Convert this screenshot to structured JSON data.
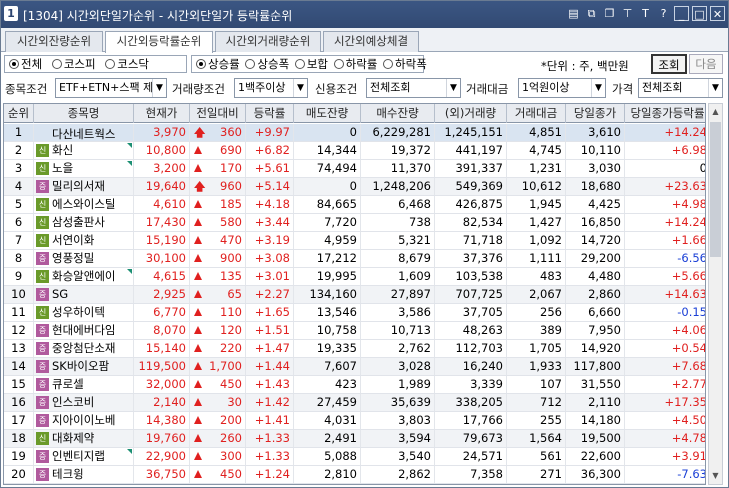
{
  "window": {
    "number": "1",
    "title": "[1304] 시간외단일가순위 - 시간외단일가 등락률순위",
    "toolbar_icons": [
      "monitor-icon",
      "copy-icon",
      "restore-icon",
      "pin-icon",
      "font-icon",
      "help-icon",
      "minimize-icon",
      "maximize-icon",
      "close-icon"
    ],
    "toolbar_glyphs": [
      "▤",
      "⧉",
      "❐",
      "⊤",
      "T",
      "?",
      "_",
      "□",
      "✕"
    ]
  },
  "tabs": [
    {
      "label": "시간외잔량순위",
      "active": false
    },
    {
      "label": "시간외등락률순위",
      "active": true
    },
    {
      "label": "시간외거래량순위",
      "active": false
    },
    {
      "label": "시간외예상체결",
      "active": false
    }
  ],
  "market_radios": [
    {
      "label": "전체",
      "checked": true
    },
    {
      "label": "코스피",
      "checked": false
    },
    {
      "label": "코스닥",
      "checked": false
    }
  ],
  "direction_radios": [
    {
      "label": "상승률",
      "checked": true
    },
    {
      "label": "상승폭",
      "checked": false
    },
    {
      "label": "보합",
      "checked": false
    },
    {
      "label": "하락률",
      "checked": false
    },
    {
      "label": "하락폭",
      "checked": false
    }
  ],
  "unit_text": "*단위 : 주, 백만원",
  "query_button": "조회",
  "next_button": "다음",
  "filters": {
    "item_condition_label": "종목조건",
    "item_condition_value": "ETF+ETN+스팩 제외",
    "volume_condition_label": "거래량조건",
    "volume_condition_value": "1백주이상",
    "credit_condition_label": "신용조건",
    "credit_condition_value": "전체조회",
    "trade_amount_label": "거래대금",
    "trade_amount_value": "1억원이상",
    "price_label": "가격",
    "price_value": "전체조회"
  },
  "table": {
    "headers": [
      "순위",
      "종목명",
      "현재가",
      "전일대비",
      "등락률",
      "매도잔량",
      "매수잔량",
      "(외)거래량",
      "거래대금",
      "당일종가",
      "당일종가등락률"
    ],
    "rows": [
      {
        "rank": "1",
        "badge": "",
        "name": "다산네트웍스",
        "flag": false,
        "price": "3,970",
        "arrow": "big",
        "change": "360",
        "rate": "+9.97",
        "ask": "0",
        "bid": "6,229,281",
        "volume": "1,245,151",
        "amount": "4,851",
        "close": "3,610",
        "close_rate": "+14.24",
        "close_dir": "up"
      },
      {
        "rank": "2",
        "badge": "신",
        "name": "화신",
        "flag": true,
        "price": "10,800",
        "arrow": "up",
        "change": "690",
        "rate": "+6.82",
        "ask": "14,344",
        "bid": "19,372",
        "volume": "441,197",
        "amount": "4,745",
        "close": "10,110",
        "close_rate": "+6.98",
        "close_dir": "up"
      },
      {
        "rank": "3",
        "badge": "신",
        "name": "노을",
        "flag": true,
        "price": "3,200",
        "arrow": "up",
        "change": "170",
        "rate": "+5.61",
        "ask": "74,494",
        "bid": "11,370",
        "volume": "391,337",
        "amount": "1,231",
        "close": "3,030",
        "close_rate": "0",
        "close_dir": "flat"
      },
      {
        "rank": "4",
        "badge": "증",
        "name": "밀리의서재",
        "flag": false,
        "price": "19,640",
        "arrow": "big",
        "change": "960",
        "rate": "+5.14",
        "ask": "0",
        "bid": "1,248,206",
        "volume": "549,369",
        "amount": "10,612",
        "close": "18,680",
        "close_rate": "+23.63",
        "close_dir": "up"
      },
      {
        "rank": "5",
        "badge": "신",
        "name": "에스와이스틸",
        "flag": false,
        "price": "4,610",
        "arrow": "up",
        "change": "185",
        "rate": "+4.18",
        "ask": "84,665",
        "bid": "6,468",
        "volume": "426,875",
        "amount": "1,945",
        "close": "4,425",
        "close_rate": "+4.98",
        "close_dir": "up"
      },
      {
        "rank": "6",
        "badge": "신",
        "name": "삼성출판사",
        "flag": false,
        "price": "17,430",
        "arrow": "up",
        "change": "580",
        "rate": "+3.44",
        "ask": "7,720",
        "bid": "738",
        "volume": "82,534",
        "amount": "1,427",
        "close": "16,850",
        "close_rate": "+14.24",
        "close_dir": "up"
      },
      {
        "rank": "7",
        "badge": "신",
        "name": "서연이화",
        "flag": false,
        "price": "15,190",
        "arrow": "up",
        "change": "470",
        "rate": "+3.19",
        "ask": "4,959",
        "bid": "5,321",
        "volume": "71,718",
        "amount": "1,092",
        "close": "14,720",
        "close_rate": "+1.66",
        "close_dir": "up"
      },
      {
        "rank": "8",
        "badge": "증",
        "name": "영풍정밀",
        "flag": false,
        "price": "30,100",
        "arrow": "up",
        "change": "900",
        "rate": "+3.08",
        "ask": "17,212",
        "bid": "8,679",
        "volume": "37,376",
        "amount": "1,111",
        "close": "29,200",
        "close_rate": "-6.56",
        "close_dir": "down"
      },
      {
        "rank": "9",
        "badge": "신",
        "name": "화승알앤에이",
        "flag": true,
        "price": "4,615",
        "arrow": "up",
        "change": "135",
        "rate": "+3.01",
        "ask": "19,995",
        "bid": "1,609",
        "volume": "103,538",
        "amount": "483",
        "close": "4,480",
        "close_rate": "+5.66",
        "close_dir": "up"
      },
      {
        "rank": "10",
        "badge": "증",
        "name": "SG",
        "flag": false,
        "price": "2,925",
        "arrow": "up",
        "change": "65",
        "rate": "+2.27",
        "ask": "134,160",
        "bid": "27,897",
        "volume": "707,725",
        "amount": "2,067",
        "close": "2,860",
        "close_rate": "+14.63",
        "close_dir": "up"
      },
      {
        "rank": "11",
        "badge": "신",
        "name": "성우하이텍",
        "flag": false,
        "price": "6,770",
        "arrow": "up",
        "change": "110",
        "rate": "+1.65",
        "ask": "13,546",
        "bid": "3,586",
        "volume": "37,705",
        "amount": "256",
        "close": "6,660",
        "close_rate": "-0.15",
        "close_dir": "down"
      },
      {
        "rank": "12",
        "badge": "증",
        "name": "현대에버다임",
        "flag": false,
        "price": "8,070",
        "arrow": "up",
        "change": "120",
        "rate": "+1.51",
        "ask": "10,758",
        "bid": "10,713",
        "volume": "48,263",
        "amount": "389",
        "close": "7,950",
        "close_rate": "+4.06",
        "close_dir": "up"
      },
      {
        "rank": "13",
        "badge": "증",
        "name": "중앙첨단소재",
        "flag": false,
        "price": "15,140",
        "arrow": "up",
        "change": "220",
        "rate": "+1.47",
        "ask": "19,335",
        "bid": "2,762",
        "volume": "112,703",
        "amount": "1,705",
        "close": "14,920",
        "close_rate": "+0.54",
        "close_dir": "up"
      },
      {
        "rank": "14",
        "badge": "증",
        "name": "SK바이오팜",
        "flag": false,
        "price": "119,500",
        "arrow": "up",
        "change": "1,700",
        "rate": "+1.44",
        "ask": "7,607",
        "bid": "3,028",
        "volume": "16,240",
        "amount": "1,933",
        "close": "117,800",
        "close_rate": "+7.68",
        "close_dir": "up"
      },
      {
        "rank": "15",
        "badge": "증",
        "name": "큐로셀",
        "flag": false,
        "price": "32,000",
        "arrow": "up",
        "change": "450",
        "rate": "+1.43",
        "ask": "423",
        "bid": "1,989",
        "volume": "3,339",
        "amount": "107",
        "close": "31,550",
        "close_rate": "+2.77",
        "close_dir": "up"
      },
      {
        "rank": "16",
        "badge": "증",
        "name": "인스코비",
        "flag": false,
        "price": "2,140",
        "arrow": "up",
        "change": "30",
        "rate": "+1.42",
        "ask": "27,459",
        "bid": "35,639",
        "volume": "338,205",
        "amount": "712",
        "close": "2,110",
        "close_rate": "+17.35",
        "close_dir": "up"
      },
      {
        "rank": "17",
        "badge": "증",
        "name": "지아이이노베",
        "flag": false,
        "price": "14,380",
        "arrow": "up",
        "change": "200",
        "rate": "+1.41",
        "ask": "4,031",
        "bid": "3,803",
        "volume": "17,766",
        "amount": "255",
        "close": "14,180",
        "close_rate": "+4.50",
        "close_dir": "up"
      },
      {
        "rank": "18",
        "badge": "신",
        "name": "대화제약",
        "flag": false,
        "price": "19,760",
        "arrow": "up",
        "change": "260",
        "rate": "+1.33",
        "ask": "2,491",
        "bid": "3,594",
        "volume": "79,673",
        "amount": "1,564",
        "close": "19,500",
        "close_rate": "+4.78",
        "close_dir": "up"
      },
      {
        "rank": "19",
        "badge": "증",
        "name": "인벤티지랩",
        "flag": true,
        "price": "22,900",
        "arrow": "up",
        "change": "300",
        "rate": "+1.33",
        "ask": "5,088",
        "bid": "3,540",
        "volume": "24,571",
        "amount": "561",
        "close": "22,600",
        "close_rate": "+3.91",
        "close_dir": "up"
      },
      {
        "rank": "20",
        "badge": "증",
        "name": "테크윙",
        "flag": false,
        "price": "36,750",
        "arrow": "up",
        "change": "450",
        "rate": "+1.24",
        "ask": "2,810",
        "bid": "2,862",
        "volume": "7,358",
        "amount": "271",
        "close": "36,300",
        "close_rate": "-7.63",
        "close_dir": "down"
      }
    ]
  },
  "colors": {
    "up": "#e0201f",
    "down": "#1a3fd6",
    "titlebar": "#324a73"
  }
}
